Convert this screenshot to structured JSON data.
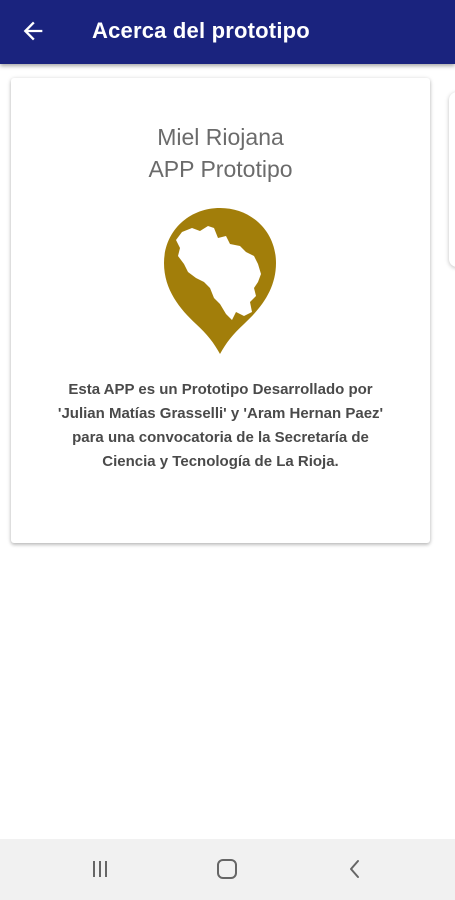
{
  "header": {
    "title": "Acerca del prototipo",
    "back_icon": "arrow-back-icon",
    "background_color": "#1a237e"
  },
  "card": {
    "app_name": "Miel Riojana",
    "app_subtitle": "APP Prototipo",
    "logo_icon": "map-pin-la-rioja-icon",
    "logo_color": "#a27e0a",
    "description_lines": [
      "Esta APP es un Prototipo Desarrollado por",
      "'Julian Matías Grasselli' y 'Aram Hernan Paez'",
      "para una convocatoria de la Secretaría de",
      "Ciencia y Tecnología de La Rioja."
    ]
  },
  "system_nav": {
    "recents_icon": "recents-icon",
    "home_icon": "home-icon",
    "back_icon": "back-chevron-icon"
  }
}
